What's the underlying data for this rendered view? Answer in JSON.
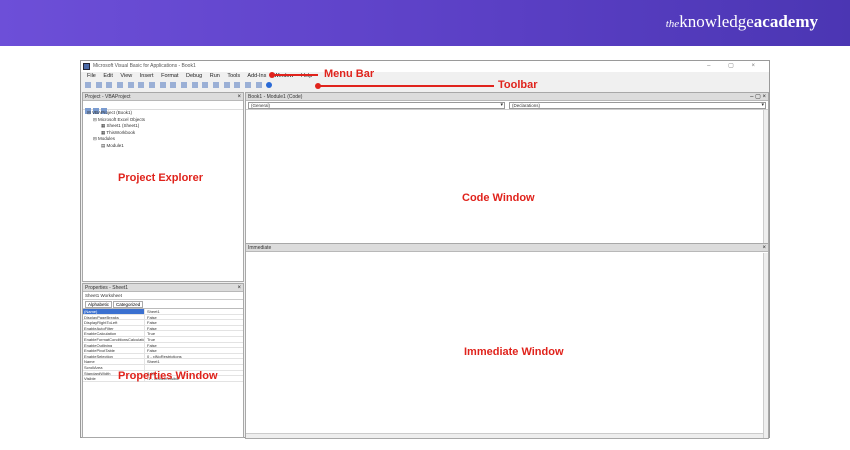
{
  "brand": {
    "prefix": "the",
    "name": "knowledge",
    "suffix": "academy"
  },
  "window": {
    "title": "Microsoft Visual Basic for Applications - Book1",
    "controls": "–  ▢  ×"
  },
  "menu": [
    "File",
    "Edit",
    "View",
    "Insert",
    "Format",
    "Debug",
    "Run",
    "Tools",
    "Add-Ins",
    "Window",
    "Help"
  ],
  "project_explorer": {
    "title": "Project - VBAProject",
    "tree": [
      "VBAProject (Book1)",
      "Microsoft Excel Objects",
      "Sheet1 (Sheet1)",
      "ThisWorkbook",
      "Modules",
      "Module1"
    ]
  },
  "properties": {
    "title": "Properties - Sheet1",
    "object": "Sheet1 Worksheet",
    "tabs": [
      "Alphabetic",
      "Categorized"
    ],
    "rows": [
      [
        "(Name)",
        "Sheet1"
      ],
      [
        "DisplayPageBreaks",
        "False"
      ],
      [
        "DisplayRightToLeft",
        "False"
      ],
      [
        "EnableAutoFilter",
        "False"
      ],
      [
        "EnableCalculation",
        "True"
      ],
      [
        "EnableFormatConditionsCalculation",
        "True"
      ],
      [
        "EnableOutlining",
        "False"
      ],
      [
        "EnablePivotTable",
        "False"
      ],
      [
        "EnableSelection",
        "0 - xlNoRestrictions"
      ],
      [
        "Name",
        "Sheet1"
      ],
      [
        "ScrollArea",
        ""
      ],
      [
        "StandardWidth",
        "8.43"
      ],
      [
        "Visible",
        "-1 - xlSheetVisible"
      ]
    ]
  },
  "code_window": {
    "title": "Book1 - Module1 (Code)",
    "left_combo": "(General)",
    "right_combo": "(Declarations)"
  },
  "immediate": {
    "title": "Immediate"
  },
  "annotations": {
    "menu_bar": "Menu Bar",
    "toolbar": "Toolbar",
    "project_explorer": "Project Explorer",
    "code_window": "Code Window",
    "properties_window": "Properties Window",
    "immediate_window": "Immediate Window"
  }
}
